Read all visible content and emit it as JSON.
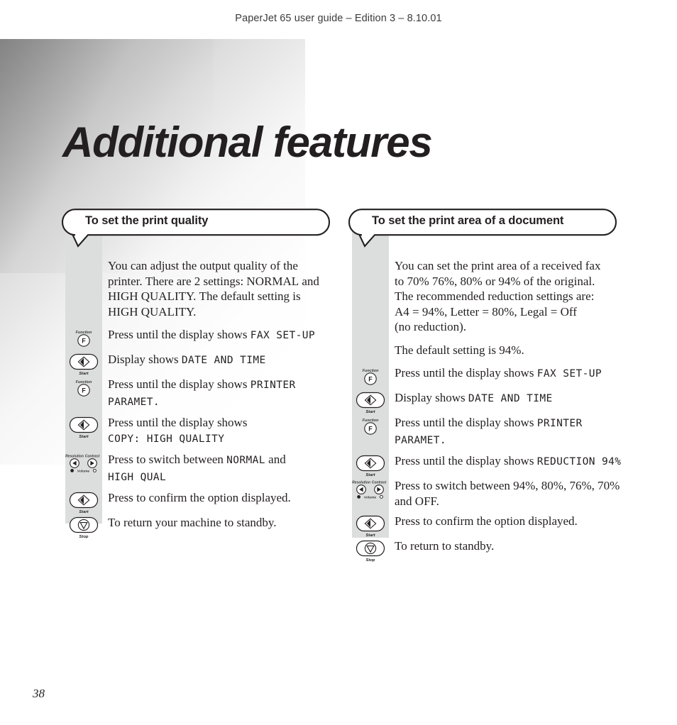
{
  "header": {
    "running_head": "PaperJet 65 user guide – Edition 3 – 8.10.01"
  },
  "page": {
    "title": "Additional features",
    "number": "38"
  },
  "icons": {
    "function_label": "Function",
    "function_key": "F",
    "start_label": "Start",
    "stop_label": "Stop",
    "resolution_label": "Resolution",
    "contrast_label": "Contrast",
    "volume_label": "Volume"
  },
  "columns": [
    {
      "heading": "To set the print quality",
      "blocks": [
        {
          "kind": "paragraph",
          "icon": "none",
          "lines": [
            {
              "runs": [
                {
                  "t": "You can adjust the output quality of the",
                  "style": "body"
                }
              ]
            },
            {
              "runs": [
                {
                  "t": "printer. There are 2 settings: NORMAL and",
                  "style": "body"
                }
              ]
            },
            {
              "runs": [
                {
                  "t": "HIGH QUALITY. The default setting is",
                  "style": "body"
                }
              ]
            },
            {
              "runs": [
                {
                  "t": "HIGH QUALITY.",
                  "style": "body"
                }
              ]
            }
          ]
        },
        {
          "kind": "step",
          "icon": "function",
          "lines": [
            {
              "runs": [
                {
                  "t": "Press until the display shows ",
                  "style": "body"
                },
                {
                  "t": "FAX SET-UP",
                  "style": "lcd"
                }
              ]
            }
          ]
        },
        {
          "kind": "step",
          "icon": "start",
          "lines": [
            {
              "runs": [
                {
                  "t": "Display shows ",
                  "style": "body"
                },
                {
                  "t": "DATE AND TIME",
                  "style": "lcd"
                }
              ]
            }
          ]
        },
        {
          "kind": "step",
          "icon": "function",
          "lines": [
            {
              "runs": [
                {
                  "t": "Press until the display shows ",
                  "style": "body"
                },
                {
                  "t": "PRINTER",
                  "style": "lcd"
                }
              ]
            },
            {
              "runs": [
                {
                  "t": "PARAMET.",
                  "style": "lcd"
                }
              ]
            }
          ]
        },
        {
          "kind": "step",
          "icon": "start",
          "lines": [
            {
              "runs": [
                {
                  "t": "Press until the display shows",
                  "style": "body"
                }
              ]
            },
            {
              "runs": [
                {
                  "t": "COPY: HIGH QUALITY",
                  "style": "lcd"
                }
              ]
            }
          ]
        },
        {
          "kind": "step",
          "icon": "arrows",
          "lines": [
            {
              "runs": [
                {
                  "t": "Press to switch between ",
                  "style": "body"
                },
                {
                  "t": "NORMAL",
                  "style": "lcd"
                },
                {
                  "t": " and",
                  "style": "body"
                }
              ]
            },
            {
              "runs": [
                {
                  "t": "HIGH QUAL",
                  "style": "lcd"
                }
              ]
            }
          ]
        },
        {
          "kind": "step",
          "icon": "start",
          "lines": [
            {
              "runs": [
                {
                  "t": "Press to confirm the option displayed.",
                  "style": "body"
                }
              ]
            }
          ]
        },
        {
          "kind": "step",
          "icon": "stop",
          "lines": [
            {
              "runs": [
                {
                  "t": "To return your machine to standby.",
                  "style": "body"
                }
              ]
            }
          ]
        }
      ]
    },
    {
      "heading": "To set the print area of a document",
      "blocks": [
        {
          "kind": "paragraph",
          "icon": "none",
          "lines": [
            {
              "runs": [
                {
                  "t": "You can set the print area of a received fax",
                  "style": "body"
                }
              ]
            },
            {
              "runs": [
                {
                  "t": "to 70% 76%, 80% or 94% of the original.",
                  "style": "body"
                }
              ]
            },
            {
              "runs": [
                {
                  "t": "The recommended reduction settings are:",
                  "style": "body"
                }
              ]
            },
            {
              "runs": [
                {
                  "t": "A4 = 94%, Letter = 80%, Legal = Off",
                  "style": "body"
                }
              ]
            },
            {
              "runs": [
                {
                  "t": "(no reduction).",
                  "style": "body"
                }
              ]
            }
          ]
        },
        {
          "kind": "paragraph",
          "icon": "none",
          "lines": [
            {
              "runs": [
                {
                  "t": "The default setting is 94%.",
                  "style": "body"
                }
              ]
            }
          ]
        },
        {
          "kind": "step",
          "icon": "function",
          "lines": [
            {
              "runs": [
                {
                  "t": "Press until the display shows ",
                  "style": "body"
                },
                {
                  "t": "FAX SET-UP",
                  "style": "lcd"
                }
              ]
            }
          ]
        },
        {
          "kind": "step",
          "icon": "start",
          "lines": [
            {
              "runs": [
                {
                  "t": "Display shows ",
                  "style": "body"
                },
                {
                  "t": "DATE AND TIME",
                  "style": "lcd"
                }
              ]
            }
          ]
        },
        {
          "kind": "step",
          "icon": "function",
          "lines": [
            {
              "runs": [
                {
                  "t": "Press until the display shows ",
                  "style": "body"
                },
                {
                  "t": "PRINTER",
                  "style": "lcd"
                }
              ]
            },
            {
              "runs": [
                {
                  "t": "PARAMET.",
                  "style": "lcd"
                }
              ]
            }
          ]
        },
        {
          "kind": "step",
          "icon": "start",
          "lines": [
            {
              "runs": [
                {
                  "t": "Press until the display shows ",
                  "style": "body"
                },
                {
                  "t": "REDUCTION 94%",
                  "style": "lcd"
                }
              ]
            }
          ]
        },
        {
          "kind": "step",
          "icon": "arrows",
          "lines": [
            {
              "runs": [
                {
                  "t": "Press to switch between 94%, 80%, 76%, 70%",
                  "style": "body"
                }
              ]
            },
            {
              "runs": [
                {
                  "t": "and OFF.",
                  "style": "body"
                }
              ]
            }
          ]
        },
        {
          "kind": "step",
          "icon": "start",
          "lines": [
            {
              "runs": [
                {
                  "t": "Press to confirm the option displayed.",
                  "style": "body"
                }
              ]
            }
          ]
        },
        {
          "kind": "step",
          "icon": "stop",
          "lines": [
            {
              "runs": [
                {
                  "t": "To return to standby.",
                  "style": "body"
                }
              ]
            }
          ]
        }
      ]
    }
  ]
}
